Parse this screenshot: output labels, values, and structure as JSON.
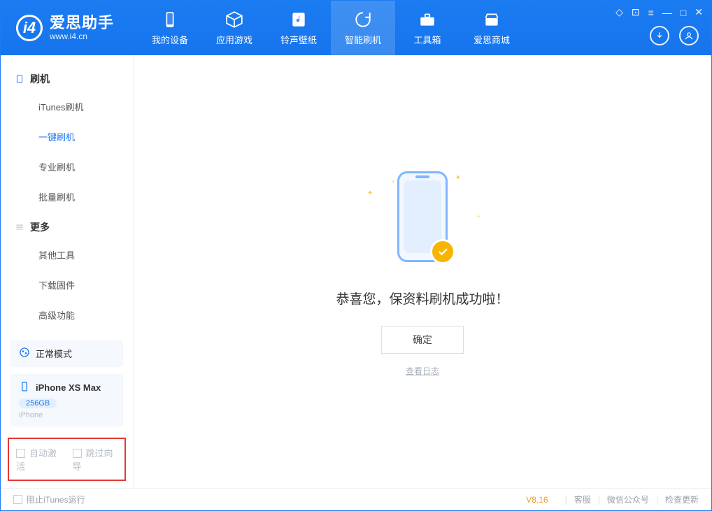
{
  "app": {
    "name_cn": "爱思助手",
    "name_en": "www.i4.cn"
  },
  "nav": [
    {
      "label": "我的设备",
      "icon": "phone"
    },
    {
      "label": "应用游戏",
      "icon": "cube"
    },
    {
      "label": "铃声壁纸",
      "icon": "music"
    },
    {
      "label": "智能刷机",
      "icon": "refresh",
      "active": true
    },
    {
      "label": "工具箱",
      "icon": "toolbox"
    },
    {
      "label": "爱思商城",
      "icon": "store"
    }
  ],
  "sidebar": {
    "group1": {
      "title": "刷机",
      "items": [
        "iTunes刷机",
        "一键刷机",
        "专业刷机",
        "批量刷机"
      ],
      "active_index": 1
    },
    "group2": {
      "title": "更多",
      "items": [
        "其他工具",
        "下载固件",
        "高级功能"
      ]
    }
  },
  "status_card": {
    "mode": "正常模式"
  },
  "device_card": {
    "name": "iPhone XS Max",
    "storage": "256GB",
    "type": "iPhone"
  },
  "red_box": {
    "opt1": "自动激活",
    "opt2": "跳过向导"
  },
  "main": {
    "success_title": "恭喜您，保资料刷机成功啦！",
    "ok": "确定",
    "view_log": "查看日志"
  },
  "footer": {
    "block_itunes": "阻止iTunes运行",
    "version": "V8.16",
    "links": [
      "客服",
      "微信公众号",
      "检查更新"
    ]
  }
}
